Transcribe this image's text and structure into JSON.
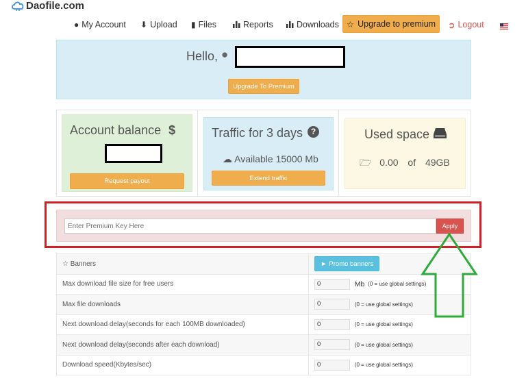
{
  "header": {
    "site_name": "Daofile.com",
    "nav": [
      {
        "label": "My Account",
        "icon": "user-icon"
      },
      {
        "label": "Upload",
        "icon": "upload-icon"
      },
      {
        "label": "Files",
        "icon": "file-icon"
      },
      {
        "label": "Reports",
        "icon": "chart-icon"
      },
      {
        "label": "Downloads",
        "icon": "chart-icon"
      }
    ],
    "premium_button": "Upgrade to premium",
    "logout": "Logout",
    "language_flag": "us-flag-icon"
  },
  "welcome": {
    "greeting": "Hello,",
    "upgrade_button": "Upgrade To Premium"
  },
  "cards": {
    "balance": {
      "title": "Account balance",
      "button": "Request payout"
    },
    "traffic": {
      "title": "Traffic for 3 days",
      "available": "Available 15000 Mb",
      "button": "Extend traffic"
    },
    "space": {
      "title": "Used space",
      "used": "0.00",
      "of": "of",
      "total": "49GB"
    }
  },
  "premium_key": {
    "placeholder": "Enter Premium Key Here",
    "apply_label": "Apply"
  },
  "settings": {
    "banners_label": "Banners",
    "promo_button": "Promo banners",
    "rows": [
      {
        "label": "Max download file size for free users",
        "value": "0",
        "unit": "Mb",
        "hint": "(0 = use global settings)"
      },
      {
        "label": "Max file downloads",
        "value": "0",
        "hint": "(0 = use global settings)"
      },
      {
        "label": "Next download delay(seconds for each 100MB downloaded)",
        "value": "0",
        "hint": "(0 = use global settings)"
      },
      {
        "label": "Next download delay(seconds after each download)",
        "value": "0",
        "hint": "(0 = use global settings)"
      },
      {
        "label": "Download speed(Kbytes/sec)",
        "value": "0",
        "hint": "(0 = use global settings)"
      }
    ]
  },
  "colors": {
    "accent_orange": "#f0ad4e",
    "danger_red": "#d9534f",
    "annotation_red": "#d11f26",
    "annotation_green": "#2eaa3a",
    "info_blue": "#d9edf7"
  }
}
